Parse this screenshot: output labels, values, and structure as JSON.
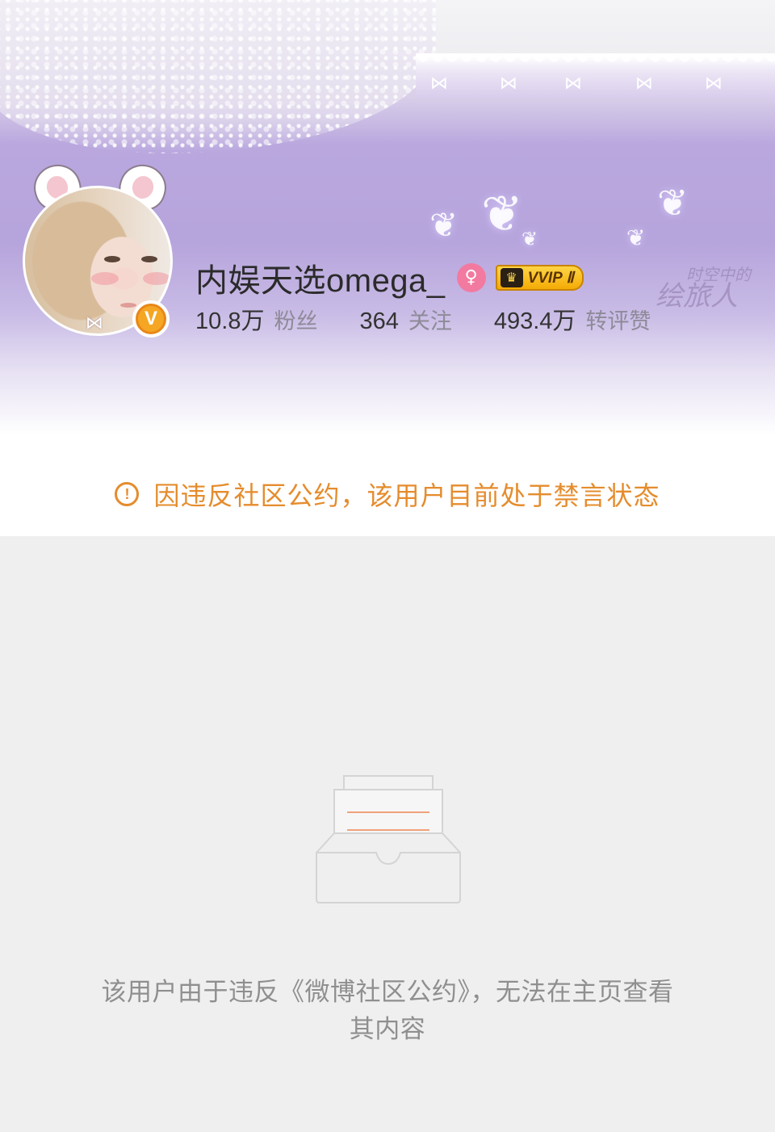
{
  "profile": {
    "username": "内娱天选omega_",
    "gender_icon": "female-icon",
    "gender_glyph": "♀",
    "verified_glyph": "V",
    "vip_label": "VVIP Ⅱ",
    "crown_glyph": "♛",
    "stats": [
      {
        "value": "10.8万",
        "label": "粉丝"
      },
      {
        "value": "364",
        "label": "关注"
      },
      {
        "value": "493.4万",
        "label": "转评赞"
      }
    ]
  },
  "banner": {
    "watermark_line1": "时空中的",
    "watermark_line2": "绘旅人",
    "bow_glyph": "⋈",
    "butterfly_glyph": "❦"
  },
  "notice": {
    "icon_glyph": "!",
    "text": "因违反社区公约，该用户目前处于禁言状态"
  },
  "empty_state": {
    "line1": "该用户由于违反《微博社区公约》，无法在主页查看",
    "line2": "其内容"
  },
  "colors": {
    "accent_orange": "#e58c2d",
    "banner_purple": "#b6a4dc",
    "gender_pink": "#f27aa0",
    "vip_gold": "#f3a800",
    "page_gray": "#efefef"
  }
}
